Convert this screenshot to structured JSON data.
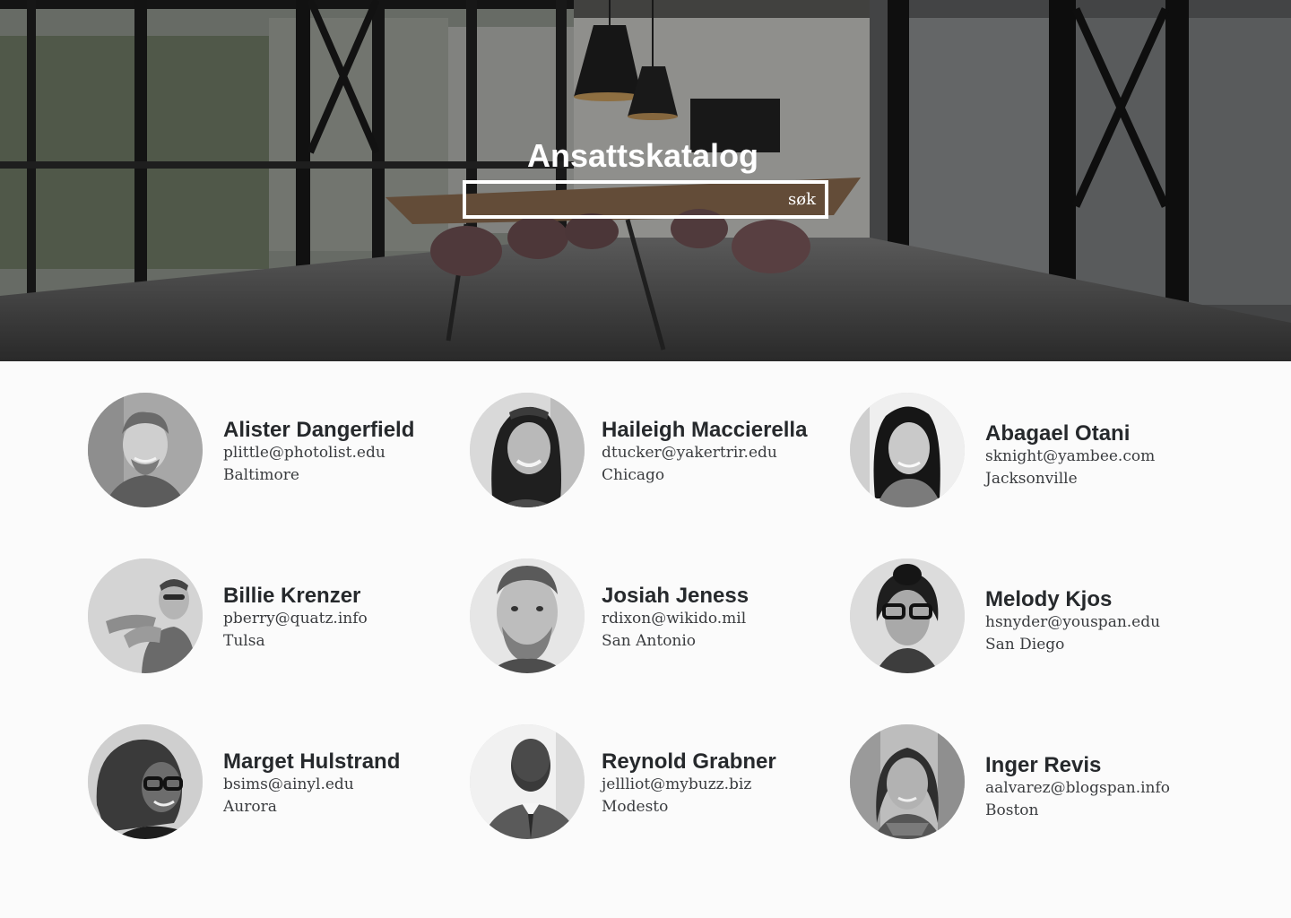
{
  "header": {
    "title": "Ansattskatalog",
    "search_value": "",
    "search_button": "søk"
  },
  "employees": [
    {
      "name": "Alister Dangerfield",
      "email": "plittle@photolist.edu",
      "city": "Baltimore"
    },
    {
      "name": "Haileigh Maccierella",
      "email": "dtucker@yakertrir.edu",
      "city": "Chicago"
    },
    {
      "name": "Abagael Otani",
      "email": "sknight@yambee.com",
      "city": "Jacksonville"
    },
    {
      "name": "Billie Krenzer",
      "email": "pberry@quatz.info",
      "city": "Tulsa"
    },
    {
      "name": "Josiah Jeness",
      "email": "rdixon@wikido.mil",
      "city": "San Antonio"
    },
    {
      "name": "Melody Kjos",
      "email": "hsnyder@youspan.edu",
      "city": "San Diego"
    },
    {
      "name": "Marget Hulstrand",
      "email": "bsims@ainyl.edu",
      "city": "Aurora"
    },
    {
      "name": "Reynold Grabner",
      "email": "jellliot@mybuzz.biz",
      "city": "Modesto"
    },
    {
      "name": "Inger Revis",
      "email": "aalvarez@blogspan.info",
      "city": "Boston"
    }
  ],
  "colors": {
    "text_dark": "#26292c",
    "text_body": "#3a3c3f",
    "page_bg": "#fbfbfb",
    "hero_text": "#ffffff"
  }
}
